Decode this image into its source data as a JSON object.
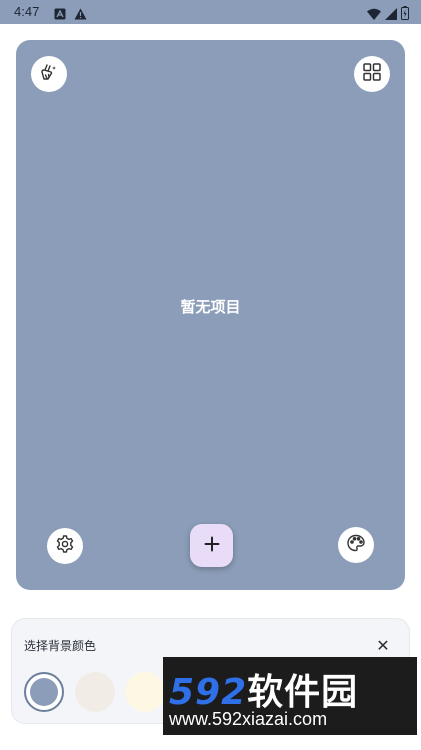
{
  "status_bar": {
    "time": "4:47",
    "icons_left": [
      "a-notification-icon",
      "warning-icon"
    ],
    "icons_right": [
      "wifi-icon",
      "signal-icon",
      "battery-icon"
    ]
  },
  "main": {
    "empty_text": "暂无项目",
    "top_left_icon": "sparkle-broom-icon",
    "top_right_icon": "grid-icon",
    "bottom_left_icon": "gear-icon",
    "bottom_right_icon": "palette-icon",
    "fab_label": "+",
    "card_color": "#8b9db8",
    "fab_color": "#e8dcf8"
  },
  "color_picker": {
    "title": "选择背景颜色",
    "close_label": "✕",
    "swatches": [
      "#8b9db8",
      "#f1ece6",
      "#fdf7e3"
    ]
  },
  "watermark": {
    "brand_number": "592",
    "brand_text": "软件园",
    "url": "www.592xiazai.com"
  }
}
